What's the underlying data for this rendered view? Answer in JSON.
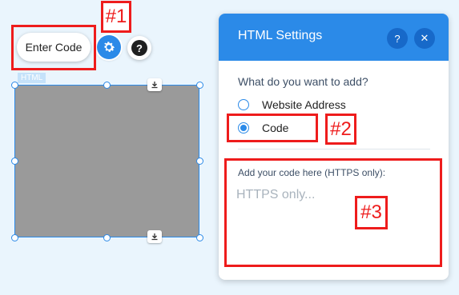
{
  "toolbar": {
    "enter_code_label": "Enter Code",
    "gear_icon": "gear-icon",
    "help_icon": "question-mark-icon",
    "help_glyph": "?"
  },
  "element": {
    "tag_label": "HTML",
    "fill_color": "#9a9a9a",
    "selection_color": "#2b8ae8",
    "download_icon": "download-arrow-icon"
  },
  "annotations": [
    {
      "label": "#1"
    },
    {
      "label": "#2"
    },
    {
      "label": "#3"
    }
  ],
  "panel": {
    "title": "HTML Settings",
    "header_color": "#2b8ae8",
    "help_glyph": "?",
    "close_glyph": "✕",
    "question": "What do you want to add?",
    "options": [
      {
        "label": "Website Address",
        "selected": false
      },
      {
        "label": "Code",
        "selected": true
      }
    ],
    "code_label": "Add your code here (HTTPS only):",
    "code_placeholder": "HTTPS only...",
    "code_value": ""
  }
}
